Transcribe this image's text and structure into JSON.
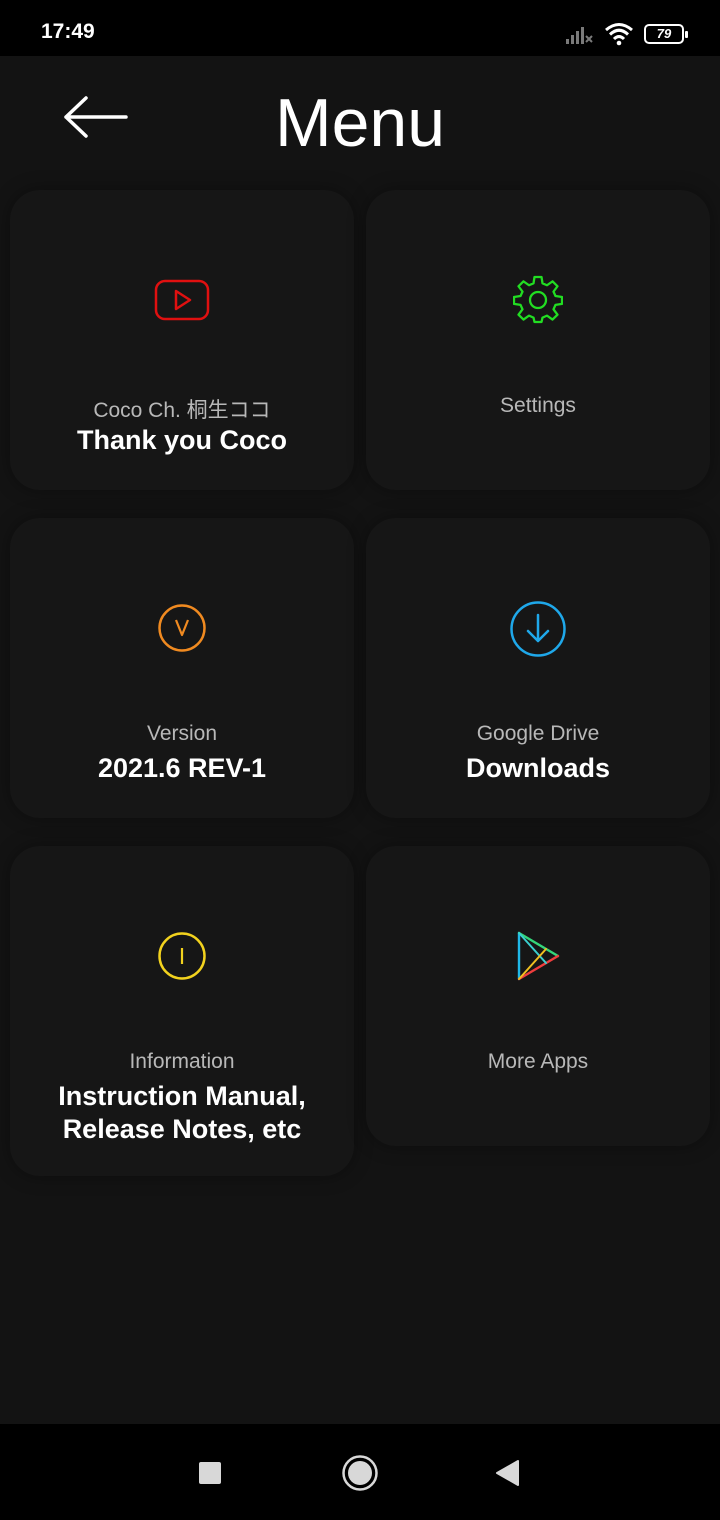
{
  "status": {
    "time": "17:49",
    "battery": "79",
    "icons": [
      "signal-icon",
      "wifi-icon",
      "battery-icon"
    ]
  },
  "header": {
    "back_icon": "arrow-left-icon",
    "title": "Menu"
  },
  "cards": [
    {
      "id": "youtube",
      "icon": "youtube-icon",
      "icon_color": "#e01010",
      "sub": "Coco Ch. 桐生ココ",
      "main": "Thank you Coco"
    },
    {
      "id": "settings",
      "icon": "gear-icon",
      "icon_color": "#22dd22",
      "sub": "Settings",
      "main": ""
    },
    {
      "id": "version",
      "icon": "version-v-icon",
      "icon_color": "#f08a20",
      "sub": "Version",
      "main": "2021.6 REV-1"
    },
    {
      "id": "drive",
      "icon": "download-icon",
      "icon_color": "#1fa8ea",
      "sub": "Google Drive",
      "main": "Downloads"
    },
    {
      "id": "information",
      "icon": "info-icon",
      "icon_color": "#f2d21e",
      "sub": "Information",
      "main_line1": "Instruction Manual,",
      "main_line2": "Release Notes, etc"
    },
    {
      "id": "more_apps",
      "icon": "play-store-icon",
      "icon_color": "#3ad0d0",
      "sub": "More Apps",
      "main": ""
    }
  ],
  "navbar": {
    "recents_icon": "square-recents-icon",
    "home_icon": "circle-home-icon",
    "back_icon": "triangle-back-icon"
  }
}
